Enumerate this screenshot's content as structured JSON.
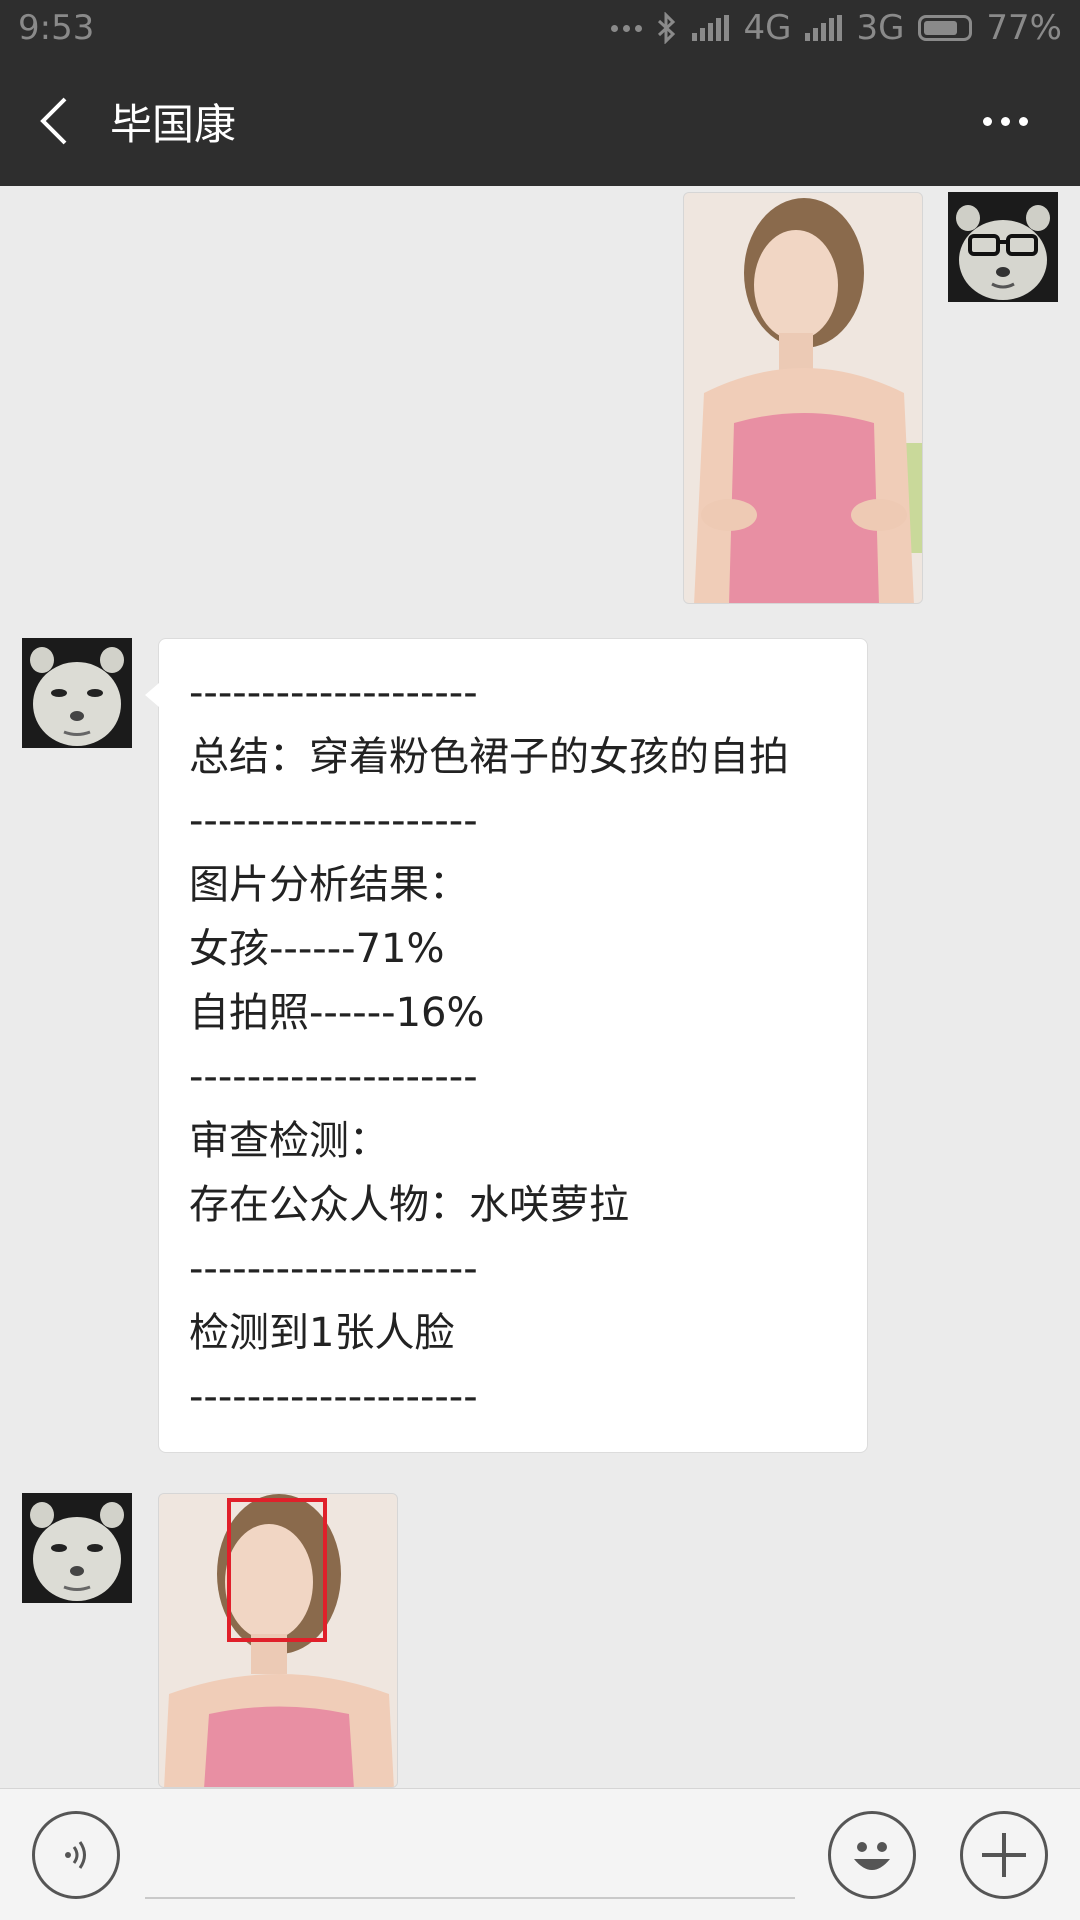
{
  "status_bar": {
    "time": "9:53",
    "network_1": "4G",
    "network_2": "3G",
    "battery": "77%",
    "battery_level": 0.77
  },
  "header": {
    "title": "毕国康"
  },
  "messages": {
    "analysis_lines": [
      "--------------------",
      "总结：穿着粉色裙子的女孩的自拍",
      "--------------------",
      "图片分析结果：",
      "女孩------71%",
      "自拍照------16%",
      "--------------------",
      "审查检测：",
      "存在公众人物：水咲萝拉",
      "--------------------",
      "检测到1张人脸",
      "--------------------"
    ]
  },
  "icons": {
    "back": "chevron-left-icon",
    "more": "more-dots-icon",
    "voice": "voice-icon",
    "emoji": "emoji-icon",
    "add": "plus-icon"
  },
  "colors": {
    "header_bg": "#2e2e2e",
    "chat_bg": "#ebebeb",
    "bubble_bg": "#ffffff",
    "face_box": "#e0202a"
  }
}
